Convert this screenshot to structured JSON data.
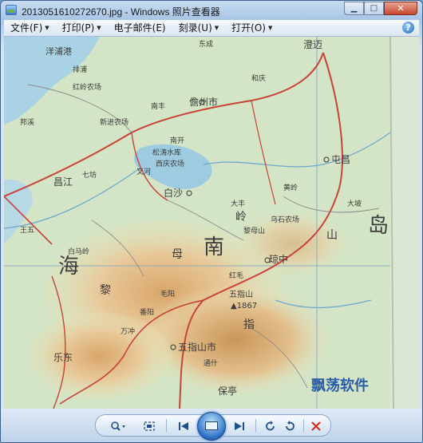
{
  "window": {
    "title": "2013051610272670.jpg - Windows 照片查看器"
  },
  "menu": {
    "items": [
      {
        "label": "文件(F)"
      },
      {
        "label": "打印(P)"
      },
      {
        "label": "电子邮件(E)"
      },
      {
        "label": "刻录(U)"
      },
      {
        "label": "打开(O)"
      }
    ]
  },
  "map": {
    "big_labels": [
      "海",
      "南",
      "岛"
    ],
    "cities": [
      "儋州市",
      "白沙",
      "琼中",
      "五指山市",
      "乐东",
      "屯昌",
      "昌江",
      "澄迈",
      "保亭"
    ],
    "mountains": [
      "黎",
      "母",
      "岭",
      "山",
      "指"
    ],
    "peak_name": "五指山",
    "peak_height": "▲1867",
    "sea_label": "洋浦港",
    "small_labels": [
      "东成",
      "排浦",
      "和庆",
      "南丰",
      "红岭农场",
      "松涛水库",
      "乌石农场",
      "毛阳",
      "红毛",
      "番阳",
      "万冲",
      "通什",
      "大丰",
      "黎母山",
      "南开",
      "邦溪",
      "七坊",
      "叉河",
      "王五",
      "西庆农场",
      "黄岭",
      "白马岭",
      "大坡",
      "新进农场"
    ]
  },
  "watermark": {
    "text": "飘荡软件"
  },
  "colors": {
    "title_bar": "#a8c5e6",
    "map_sea": "#a9d3e4",
    "map_land": "#d9e6c9",
    "map_mountain": "#e8c99a",
    "road_red": "#c8423a",
    "watermark": "#2b5ea8"
  },
  "toolbar": {
    "zoom_icon": "magnifier-icon",
    "fit_icon": "actual-size-icon",
    "prev_icon": "previous-icon",
    "slideshow_icon": "slideshow-icon",
    "next_icon": "next-icon",
    "rotate_ccw_icon": "rotate-counterclockwise-icon",
    "rotate_cw_icon": "rotate-clockwise-icon",
    "delete_icon": "delete-icon"
  }
}
